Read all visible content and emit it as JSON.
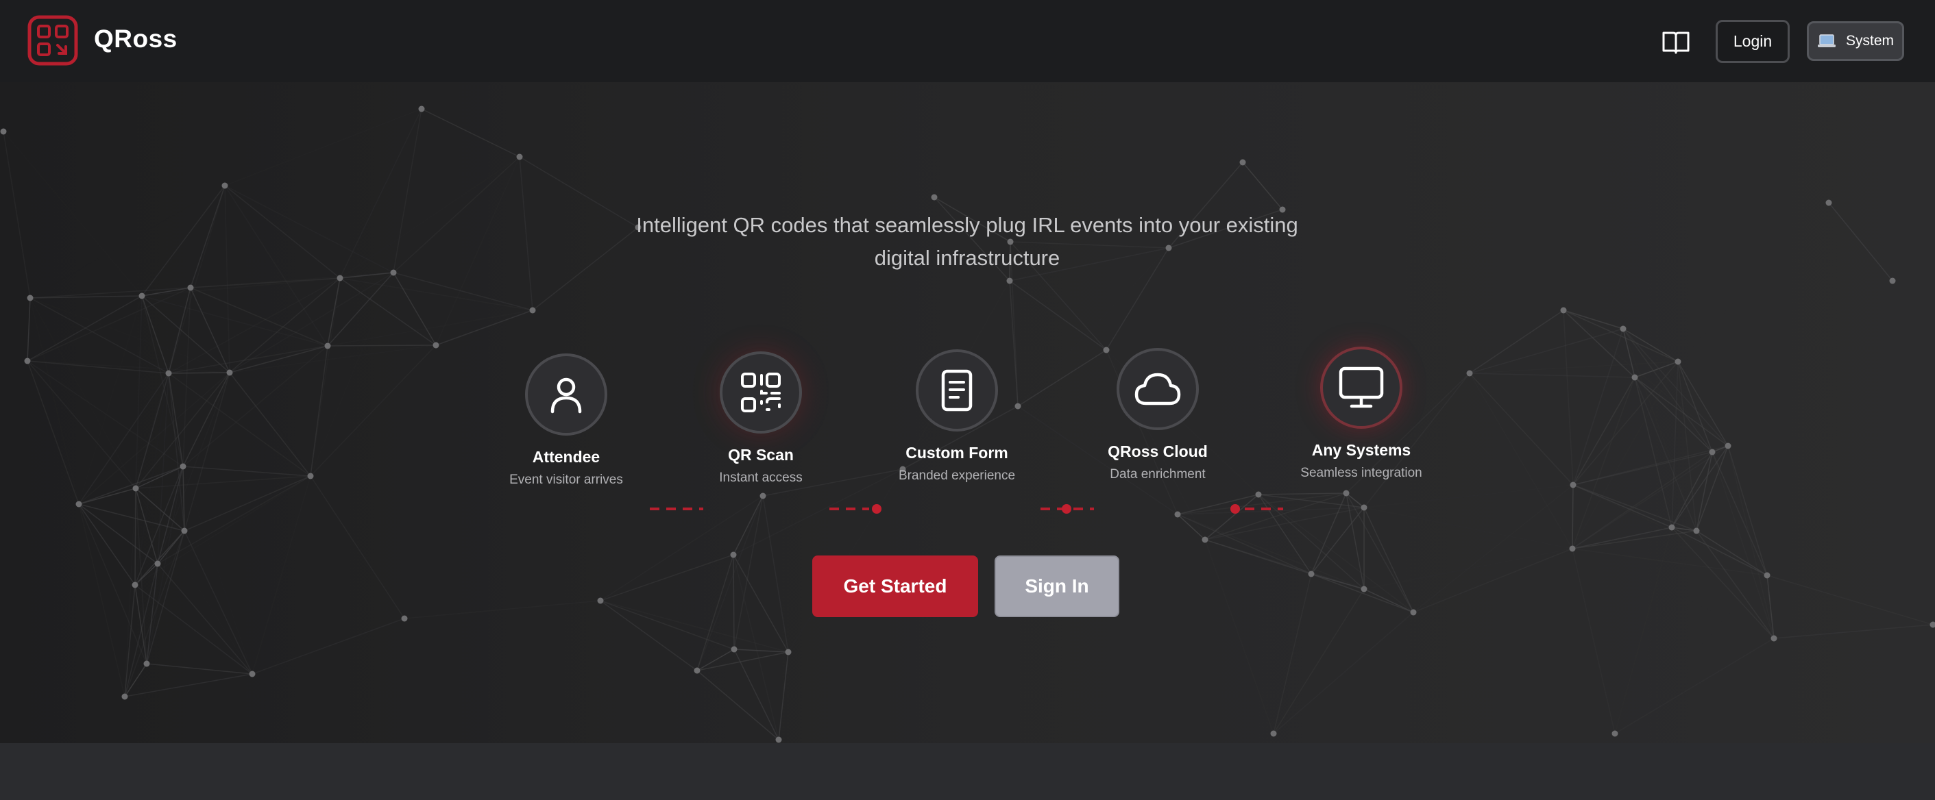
{
  "header": {
    "brand": "QRoss",
    "logo_icon": "qr-logo-icon",
    "docs_icon": "book-icon",
    "login_label": "Login",
    "system_icon": "laptop-icon",
    "system_label": "System"
  },
  "hero": {
    "tagline": "Intelligent QR codes that seamlessly plug IRL events into your existing digital infrastructure",
    "steps": [
      {
        "label": "Attendee",
        "sub": "Event visitor arrives",
        "icon": "user-icon"
      },
      {
        "label": "QR Scan",
        "sub": "Instant access",
        "icon": "qr-code-icon"
      },
      {
        "label": "Custom Form",
        "sub": "Branded experience",
        "icon": "document-icon"
      },
      {
        "label": "QRoss Cloud",
        "sub": "Data enrichment",
        "icon": "cloud-icon"
      },
      {
        "label": "Any Systems",
        "sub": "Seamless integration",
        "icon": "monitor-icon"
      }
    ],
    "primary_cta": "Get Started",
    "secondary_cta": "Sign In"
  },
  "colors": {
    "accent": "#b71f2e",
    "header_bg": "#1c1d1f",
    "hero_bg": "#272728",
    "secondary_button": "#a2a3ad"
  }
}
